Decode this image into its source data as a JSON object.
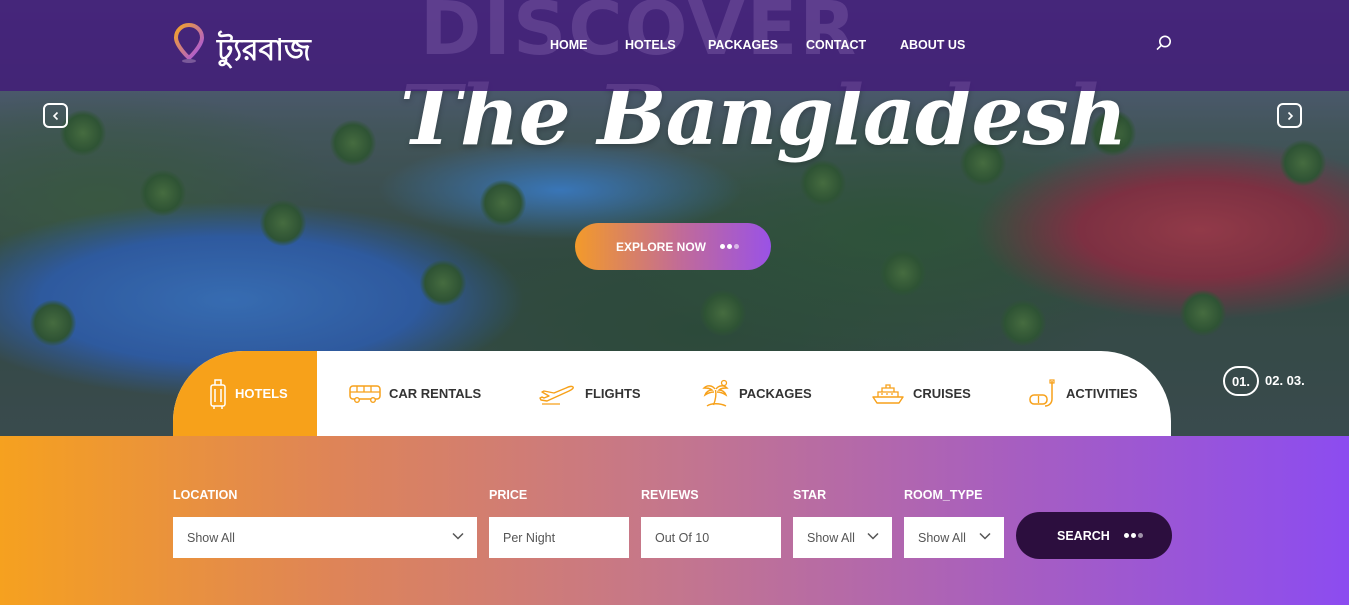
{
  "brand": {
    "logo_text": "ট্যুরবাজ",
    "background_word": "DISCOVER"
  },
  "nav": {
    "items": [
      "HOME",
      "HOTELS",
      "PACKAGES",
      "CONTACT",
      "ABOUT US"
    ]
  },
  "hero": {
    "headline": "The Bangladesh",
    "cta_label": "EXPLORE NOW",
    "pager": {
      "current": "01.",
      "others": "02. 03."
    }
  },
  "tabs": [
    {
      "label": "HOTELS",
      "icon": "luggage-icon",
      "active": true
    },
    {
      "label": "CAR RENTALS",
      "icon": "bus-icon",
      "active": false
    },
    {
      "label": "FLIGHTS",
      "icon": "airplane-icon",
      "active": false
    },
    {
      "label": "PACKAGES",
      "icon": "palm-tree-icon",
      "active": false
    },
    {
      "label": "CRUISES",
      "icon": "ship-icon",
      "active": false
    },
    {
      "label": "ACTIVITIES",
      "icon": "snorkel-icon",
      "active": false
    }
  ],
  "filters": {
    "location": {
      "label": "LOCATION",
      "value": "Show All"
    },
    "price": {
      "label": "PRICE",
      "placeholder": "Per Night"
    },
    "reviews": {
      "label": "REVIEWS",
      "placeholder": "Out Of 10"
    },
    "star": {
      "label": "STAR",
      "value": "Show All"
    },
    "room_type": {
      "label": "ROOM_TYPE",
      "value": "Show All"
    },
    "search_label": "SEARCH"
  },
  "colors": {
    "accent_orange": "#f7a11a",
    "accent_purple": "#8c4cf0",
    "topbar": "#421e78",
    "search_button": "#2c0e3e"
  }
}
